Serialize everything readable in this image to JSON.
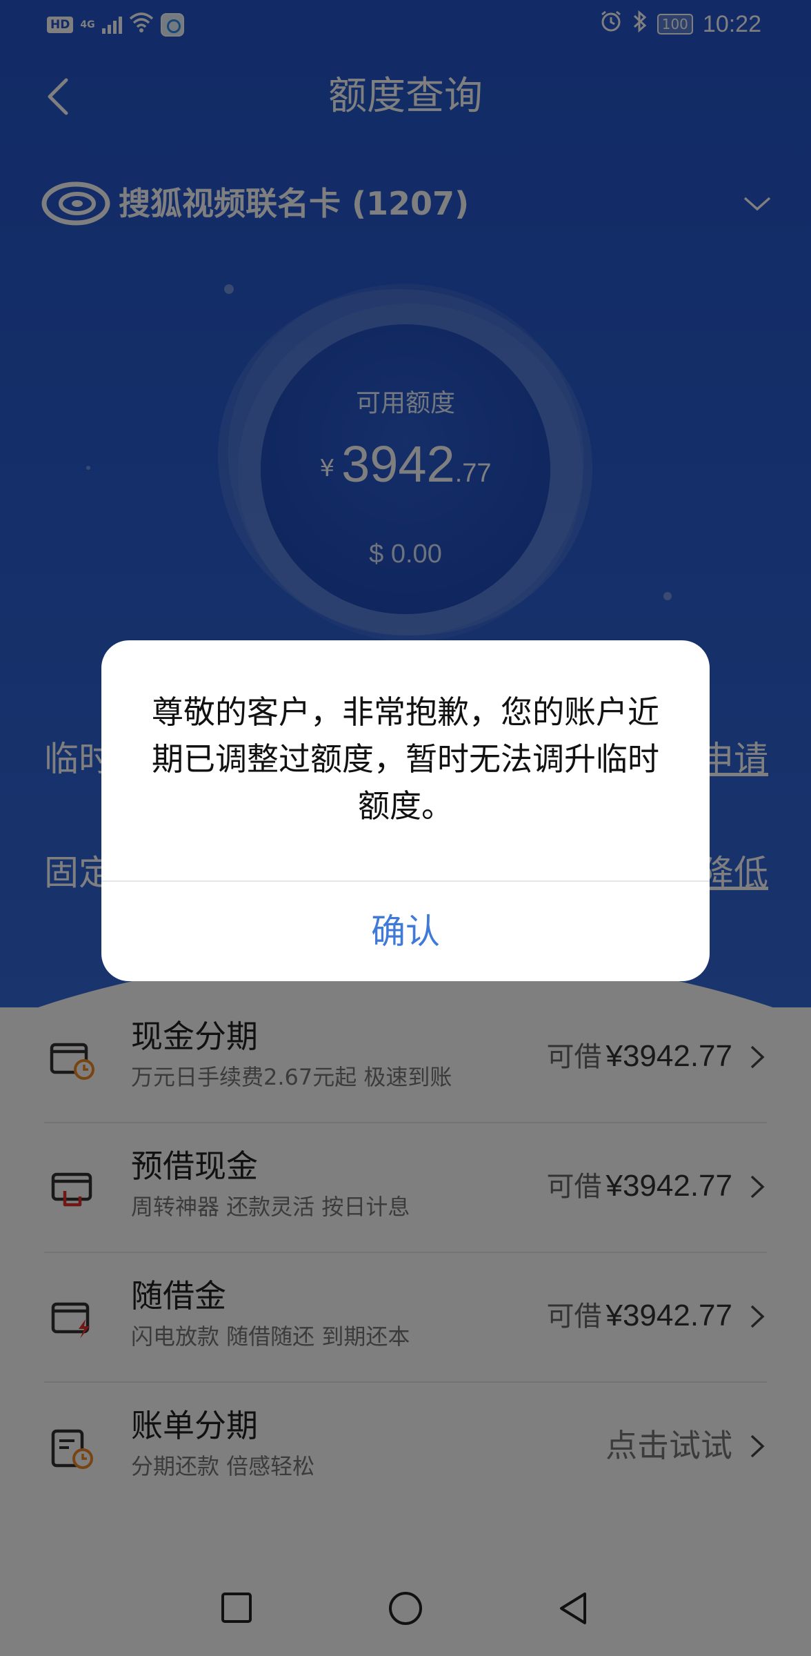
{
  "status_bar": {
    "hd": "HD",
    "network": "4G",
    "battery": "100",
    "time": "10:22"
  },
  "header": {
    "title": "额度查询",
    "back_icon": "back-arrow-icon"
  },
  "card": {
    "name": "搜狐视频联名卡 (1207)",
    "logo_icon": "sohu-logo-icon",
    "dropdown_icon": "chevron-down-icon"
  },
  "available": {
    "label": "可用额度",
    "currency": "¥",
    "integer": "3942",
    "decimal": ".77",
    "usd": "$ 0.00"
  },
  "limits": {
    "temporary_label": "临时",
    "temporary_action": "申请",
    "fixed_label": "固定",
    "fixed_action": "降低"
  },
  "services": [
    {
      "title": "现金分期",
      "subtitle": "万元日手续费2.67元起 极速到账",
      "prefix": "可借",
      "amount": "¥3942.77",
      "icon": "cash-installment-icon"
    },
    {
      "title": "预借现金",
      "subtitle": "周转神器 还款灵活 按日计息",
      "prefix": "可借",
      "amount": "¥3942.77",
      "icon": "cash-advance-icon"
    },
    {
      "title": "随借金",
      "subtitle": "闪电放款 随借随还 到期还本",
      "prefix": "可借",
      "amount": "¥3942.77",
      "icon": "flash-loan-icon"
    },
    {
      "title": "账单分期",
      "subtitle": "分期还款 倍感轻松",
      "action": "点击试试",
      "icon": "bill-installment-icon"
    }
  ],
  "dialog": {
    "message": "尊敬的客户，非常抱歉，您的账户近期已调整过额度，暂时无法调升临时额度。",
    "confirm_label": "确认"
  },
  "colors": {
    "header_blue": "#2456cc",
    "accent": "#3f7ad8",
    "icon_orange": "#f08a24",
    "icon_red": "#e0302b"
  }
}
